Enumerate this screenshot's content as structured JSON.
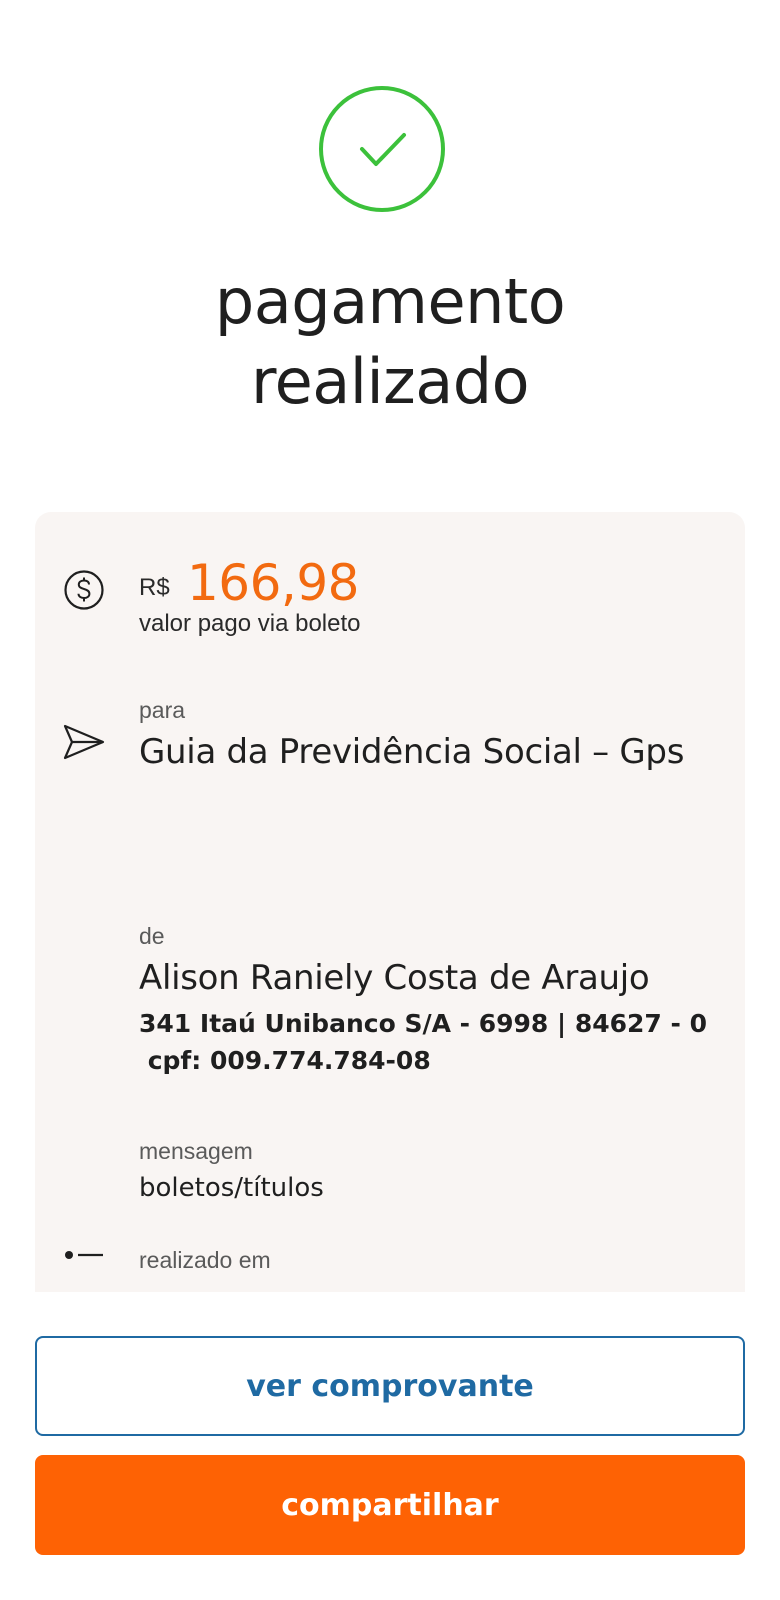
{
  "status": {
    "icon": "check-circle-icon",
    "title_line1": "pagamento",
    "title_line2": "realizado",
    "accent_color": "#3cc13b"
  },
  "payment": {
    "currency": "R$",
    "amount": "166,98",
    "amount_caption": "valor pago via boleto",
    "amount_icon": "dollar-circle-icon",
    "amount_color": "#f26a10"
  },
  "recipient": {
    "icon": "send-icon",
    "label": "para",
    "name": "Guia da Previdência Social – Gps"
  },
  "payer": {
    "label": "de",
    "name": "Alison Raniely Costa de Araujo",
    "bank_line": "341 Itaú Unibanco S/A - 6998 | 84627 - 0",
    "cpf_line": " cpf: 009.774.784-08"
  },
  "message": {
    "label": "mensagem",
    "value": "boletos/títulos"
  },
  "date": {
    "icon": "list-icon",
    "label": "realizado em"
  },
  "actions": {
    "view_receipt": "ver comprovante",
    "share": "compartilhar",
    "primary_color": "#fe6204",
    "outline_color": "#1f6aa3"
  }
}
